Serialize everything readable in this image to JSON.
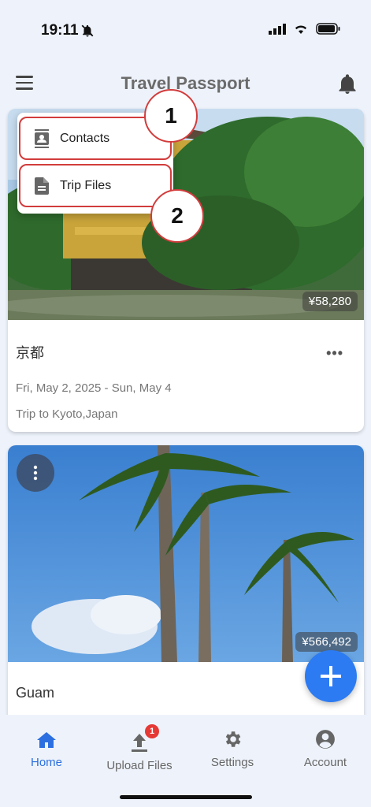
{
  "status_bar": {
    "time": "19:11"
  },
  "app_bar": {
    "title": "Travel Passport"
  },
  "popup_menu": {
    "items": [
      {
        "label": "Contacts",
        "icon": "contacts-icon"
      },
      {
        "label": "Trip Files",
        "icon": "file-icon"
      }
    ],
    "callouts": [
      "1",
      "2"
    ]
  },
  "trips": [
    {
      "name": "京都",
      "price": "¥58,280",
      "dates": "Fri, May 2, 2025 - Sun, May 4",
      "description": "Trip to Kyoto,Japan"
    },
    {
      "name": "Guam",
      "price": "¥566,492"
    }
  ],
  "bottom_nav": {
    "items": [
      {
        "label": "Home",
        "icon": "home-icon",
        "active": true
      },
      {
        "label": "Upload Files",
        "icon": "upload-icon",
        "badge": "1"
      },
      {
        "label": "Settings",
        "icon": "gear-icon"
      },
      {
        "label": "Account",
        "icon": "account-icon"
      }
    ]
  },
  "colors": {
    "accent": "#2c7bf2",
    "callout_border": "#d23c3c",
    "badge": "#e53935"
  }
}
